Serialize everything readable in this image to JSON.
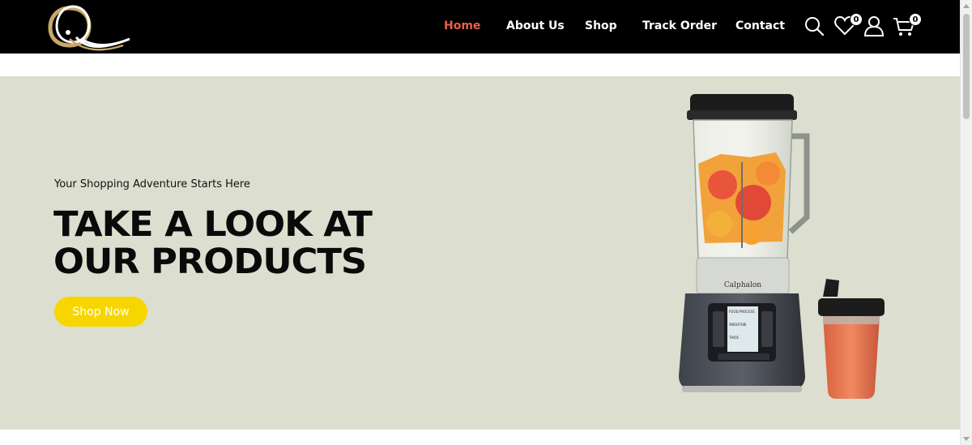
{
  "header": {
    "logo_letter": "Q",
    "nav": [
      {
        "label": "Home",
        "active": true
      },
      {
        "label": "About Us",
        "active": false
      },
      {
        "label": "Shop",
        "active": false
      },
      {
        "label": "Track Order",
        "active": false
      },
      {
        "label": "Contact",
        "active": false
      }
    ],
    "icons": {
      "search": "search-icon",
      "wishlist": "heart-icon",
      "account": "user-icon",
      "cart": "cart-icon"
    },
    "wishlist_count": "0",
    "cart_count": "0"
  },
  "hero": {
    "tagline": "Your Shopping Adventure Starts Here",
    "headline_line1": "TAKE A LOOK AT",
    "headline_line2": "OUR PRODUCTS",
    "cta_label": "Shop Now",
    "product_brand": "Calphalon",
    "product_screen_lines": [
      "FOOD PROCESS",
      "SMOOTHIE",
      "THICK"
    ]
  },
  "colors": {
    "header_bg": "#000000",
    "nav_active": "#e8604c",
    "hero_bg": "#dcdfcf",
    "cta_bg": "#f7d600",
    "logo_gold": "#c8a86a"
  }
}
